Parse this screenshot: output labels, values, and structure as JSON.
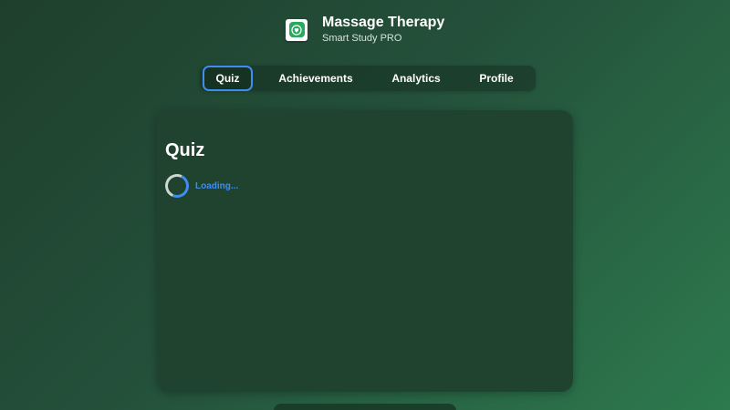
{
  "app": {
    "title": "Massage Therapy",
    "subtitle": "Smart Study PRO",
    "icon": "heart-hands-icon"
  },
  "nav": {
    "tabs": [
      {
        "label": "Quiz",
        "active": true
      },
      {
        "label": "Achievements",
        "active": false
      },
      {
        "label": "Analytics",
        "active": false
      },
      {
        "label": "Profile",
        "active": false
      }
    ]
  },
  "main": {
    "title": "Quiz",
    "loading_text": "Loading..."
  },
  "colors": {
    "accent": "#3f8df0",
    "brand": "#2aa860",
    "card": "#20432f"
  }
}
